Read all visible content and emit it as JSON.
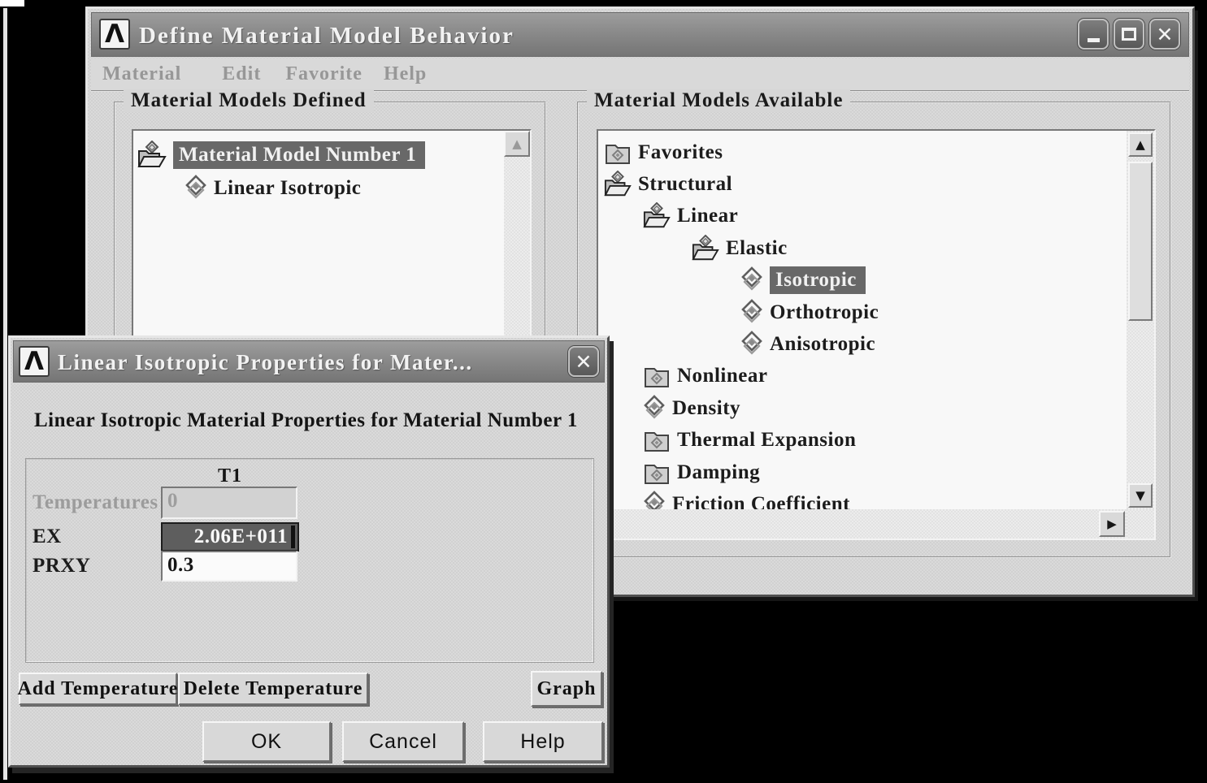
{
  "colors": {
    "desktop_bg": "#000000",
    "window_bg": "#d6d6d6",
    "titlebar_gray": "#8a8a8a",
    "selection_bg": "#686868",
    "selection_text": "#f1f1f1",
    "listbox_bg": "#f8f8f8",
    "selected_field_bg": "#5e5e5e",
    "disabled_text": "#9c9c9c"
  },
  "glyphs": {
    "ansys_logo": "Λ",
    "close": "✕",
    "arrow_up": "▲",
    "arrow_down": "▼",
    "arrow_right": "▶"
  },
  "main_window": {
    "title": "Define Material Model Behavior",
    "menu": {
      "items": [
        "Material",
        "Edit",
        "Favorite",
        "Help"
      ]
    },
    "defined_panel": {
      "label": "Material Models Defined",
      "items": [
        {
          "label": "Material Model Number 1",
          "icon": "open-folder",
          "selected": true
        },
        {
          "label": "Linear Isotropic",
          "icon": "material-property-diamond",
          "selected": false
        }
      ]
    },
    "available_panel": {
      "label": "Material Models Available",
      "items": [
        {
          "label": "Favorites",
          "icon": "closed-folder",
          "level": 0,
          "selected": false
        },
        {
          "label": "Structural",
          "icon": "open-folder",
          "level": 0,
          "selected": false
        },
        {
          "label": "Linear",
          "icon": "open-folder",
          "level": 1,
          "selected": false
        },
        {
          "label": "Elastic",
          "icon": "open-folder",
          "level": 2,
          "selected": false
        },
        {
          "label": "Isotropic",
          "icon": "material-property-diamond",
          "level": 3,
          "selected": true
        },
        {
          "label": "Orthotropic",
          "icon": "material-property-diamond",
          "level": 3,
          "selected": false
        },
        {
          "label": "Anisotropic",
          "icon": "material-property-diamond",
          "level": 3,
          "selected": false
        },
        {
          "label": "Nonlinear",
          "icon": "closed-folder",
          "level": 1,
          "selected": false
        },
        {
          "label": "Density",
          "icon": "material-property-diamond",
          "level": 1,
          "selected": false
        },
        {
          "label": "Thermal Expansion",
          "icon": "closed-folder",
          "level": 1,
          "selected": false
        },
        {
          "label": "Damping",
          "icon": "closed-folder",
          "level": 1,
          "selected": false
        },
        {
          "label": "Friction Coefficient",
          "icon": "material-property-diamond",
          "level": 1,
          "selected": false,
          "clipped": true
        }
      ]
    }
  },
  "dialog": {
    "title": "Linear Isotropic Properties for Mater...",
    "heading": "Linear Isotropic Material Properties for Material Number 1",
    "table": {
      "column_header": "T1",
      "rows": [
        {
          "label": "Temperatures",
          "value": "0",
          "state": "disabled"
        },
        {
          "label": "EX",
          "value": "2.06E+011",
          "state": "selected"
        },
        {
          "label": "PRXY",
          "value": "0.3",
          "state": "normal"
        }
      ]
    },
    "action_buttons": {
      "add": "Add Temperature",
      "delete": "Delete Temperature",
      "graph": "Graph"
    },
    "footer_buttons": {
      "ok": "OK",
      "cancel": "Cancel",
      "help": "Help"
    }
  }
}
